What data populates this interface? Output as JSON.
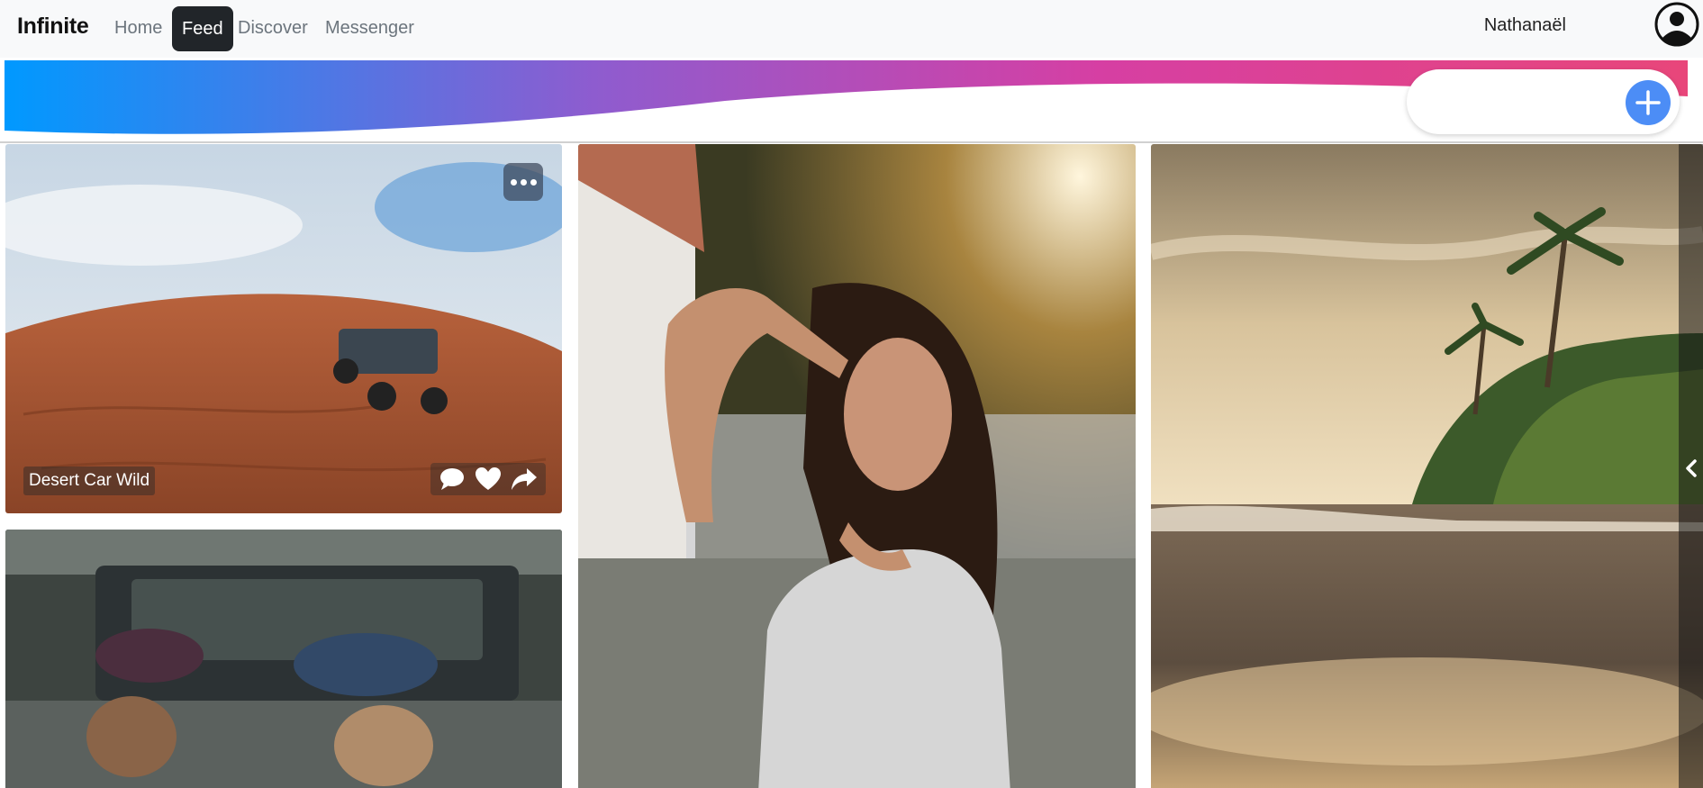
{
  "navbar": {
    "brand": "Infinite",
    "links": [
      {
        "label": "Home",
        "active": false
      },
      {
        "label": "Feed",
        "active": true
      },
      {
        "label": "Discover",
        "active": false
      },
      {
        "label": "Messenger",
        "active": false
      }
    ],
    "user_name": "Nathanaël",
    "avatar_icon": "user-circle-icon"
  },
  "banner": {
    "gradient_colors": [
      "#0099ff",
      "#8e5ccf",
      "#d63fa3",
      "#e8467a"
    ],
    "search": {
      "value": "",
      "placeholder": ""
    },
    "add_icon": "plus-icon",
    "add_color": "#4c8df6"
  },
  "feed": {
    "posts": [
      {
        "caption": "Desert Car Wild",
        "menu_icon": "ellipsis-icon",
        "actions": [
          "comment-icon",
          "heart-icon",
          "share-icon"
        ]
      }
    ]
  },
  "side_panel": {
    "toggle_icon": "chevron-left-icon"
  }
}
